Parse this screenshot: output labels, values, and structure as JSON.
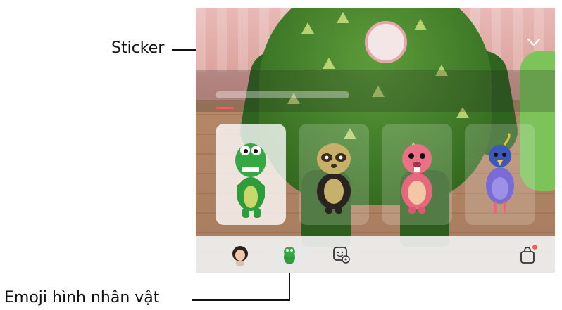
{
  "callouts": {
    "sticker": "Sticker",
    "avatar_emoji": "Emoji hình nhân vật"
  },
  "icons": {
    "collapse": "chevron-down-icon",
    "my_emoji": "my-emoji-avatar-icon",
    "character": "dinosaur-character-icon",
    "sticker_settings": "sticker-settings-icon",
    "store": "shopping-bag-icon"
  },
  "carousel": {
    "characters": [
      {
        "name": "dinosaur-character",
        "selected": true,
        "color": "#2f9c3b"
      },
      {
        "name": "sloth-character",
        "selected": false,
        "color": "#c7b16a"
      },
      {
        "name": "beaver-character",
        "selected": false,
        "color": "#e7677c"
      },
      {
        "name": "bird-character",
        "selected": false,
        "color": "#7a6bd6"
      }
    ]
  },
  "colors": {
    "accent_red": "#ff5a5a",
    "monster_green": "#3f7a27"
  }
}
